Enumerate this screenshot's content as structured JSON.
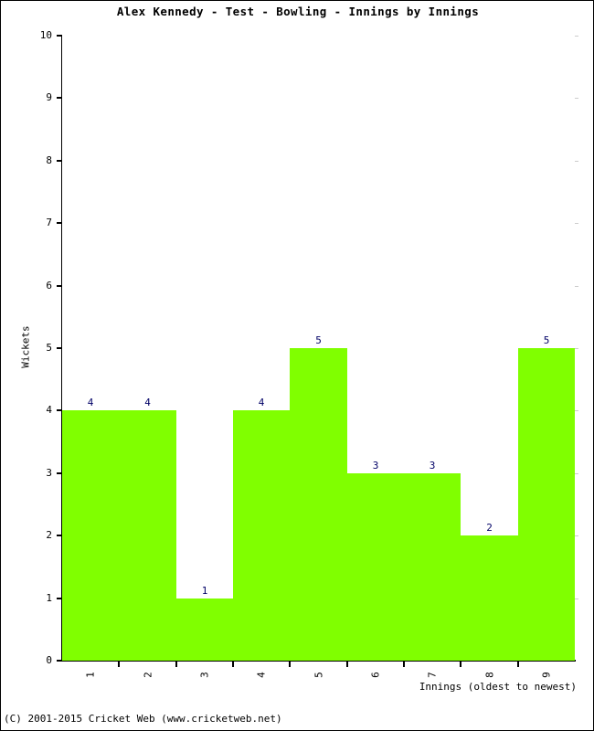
{
  "chart_data": {
    "type": "bar",
    "title": "Alex Kennedy - Test - Bowling - Innings by Innings",
    "xlabel": "Innings (oldest to newest)",
    "ylabel": "Wickets",
    "categories": [
      "1",
      "2",
      "3",
      "4",
      "5",
      "6",
      "7",
      "8",
      "9"
    ],
    "values": [
      4,
      4,
      1,
      4,
      5,
      3,
      3,
      2,
      5
    ],
    "data_labels": [
      "4",
      "4",
      "1",
      "4",
      "5",
      "3",
      "3",
      "2",
      "5"
    ],
    "ylim": [
      0,
      10
    ],
    "ytick_labels": [
      "0",
      "1",
      "2",
      "3",
      "4",
      "5",
      "6",
      "7",
      "8",
      "9",
      "10"
    ],
    "ytick_values": [
      0,
      1,
      2,
      3,
      4,
      5,
      6,
      7,
      8,
      9,
      10
    ],
    "grid": true,
    "legend": false,
    "bar_color": "#80ff00",
    "data_label_color": "#000066",
    "grid_color": "#cccccc",
    "axis_color": "#000000"
  },
  "footer": {
    "copyright": "(C) 2001-2015 Cricket Web (www.cricketweb.net)"
  }
}
